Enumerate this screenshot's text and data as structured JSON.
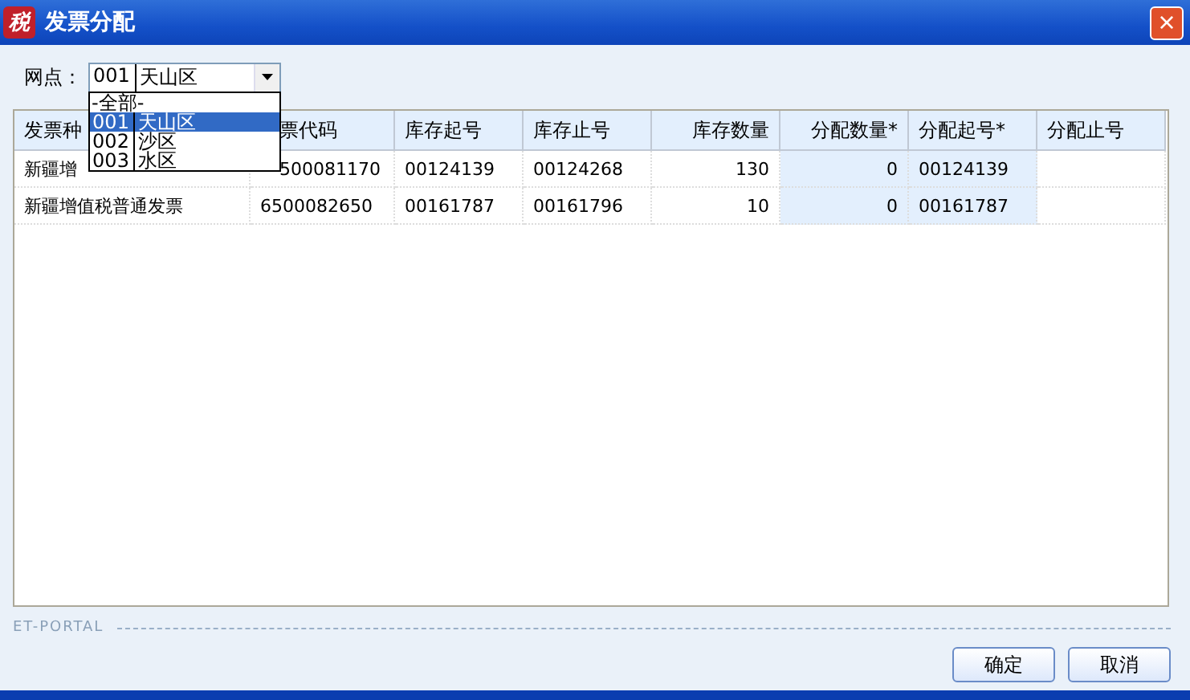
{
  "window": {
    "icon_text": "税",
    "title": "发票分配",
    "close": "×"
  },
  "filter": {
    "label": "网点：",
    "value": {
      "code": "001",
      "name": "天山区"
    },
    "options": [
      {
        "name": "-全部-",
        "selected": false
      },
      {
        "code": "001",
        "name": "天山区",
        "selected": true
      },
      {
        "code": "002",
        "name": "沙区",
        "selected": false
      },
      {
        "code": "003",
        "name": "水区",
        "selected": false
      }
    ]
  },
  "table": {
    "columns": [
      {
        "label": "发票种",
        "editable": false
      },
      {
        "label": "票代码",
        "editable": false
      },
      {
        "label": "库存起号",
        "editable": false
      },
      {
        "label": "库存止号",
        "editable": false
      },
      {
        "label": "库存数量",
        "editable": false
      },
      {
        "label": "分配数量*",
        "editable": true
      },
      {
        "label": "分配起号*",
        "editable": true
      },
      {
        "label": "分配止号",
        "editable": false
      }
    ],
    "rows": [
      [
        "新疆增",
        "500081170",
        "00124139",
        "00124268",
        "130",
        "0",
        "00124139",
        ""
      ],
      [
        "新疆增值税普通发票",
        "6500082650",
        "00161787",
        "00161796",
        "10",
        "0",
        "00161787",
        ""
      ]
    ]
  },
  "footer": {
    "brand": "ET-PORTAL",
    "buttons": [
      "确定",
      "取消"
    ]
  }
}
